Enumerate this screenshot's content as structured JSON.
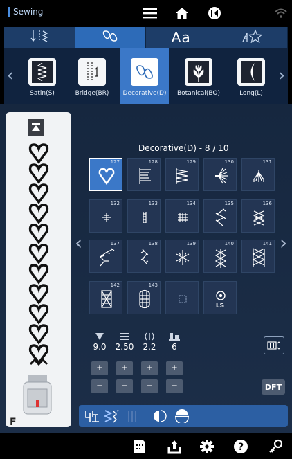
{
  "app": {
    "title": "Sewing"
  },
  "categories": [
    {
      "icon": "utility-stitch-icon"
    },
    {
      "icon": "decorative-stitch-icon"
    },
    {
      "icon": "character-font-icon",
      "label": "Aa"
    },
    {
      "icon": "stitch-favorites-icon"
    }
  ],
  "subcategories": [
    {
      "label": "Satin(S)",
      "icon": "satin-stitch-icon"
    },
    {
      "label": "Bridge(BR)",
      "icon": "bridge-stitch-icon"
    },
    {
      "label": "Decorative(D)",
      "icon": "decorative-stitch-icon",
      "active": true
    },
    {
      "label": "Botanical(BO)",
      "icon": "botanical-stitch-icon"
    },
    {
      "label": "Long(L)",
      "icon": "long-stitch-icon"
    }
  ],
  "grid": {
    "title": "Decorative(D) - 8 / 10",
    "selected": "127",
    "cells": [
      {
        "num": "127",
        "icon": "heart-stitch-icon"
      },
      {
        "num": "128",
        "icon": "comb-stitch-icon"
      },
      {
        "num": "129",
        "icon": "zigzag-comb-stitch-icon"
      },
      {
        "num": "130",
        "icon": "fan-stitch-icon"
      },
      {
        "num": "131",
        "icon": "crown-stitch-icon"
      },
      {
        "num": "132",
        "icon": "cross-stitch-icon"
      },
      {
        "num": "133",
        "icon": "ladder-stitch-icon"
      },
      {
        "num": "134",
        "icon": "hash-stitch-icon"
      },
      {
        "num": "135",
        "icon": "feather-stitch-icon"
      },
      {
        "num": "136",
        "icon": "star-stitch-icon"
      },
      {
        "num": "137",
        "icon": "branch-stitch-icon"
      },
      {
        "num": "138",
        "icon": "vine-stitch-icon"
      },
      {
        "num": "139",
        "icon": "snowflake-stitch-icon"
      },
      {
        "num": "140",
        "icon": "cross-chain-stitch-icon"
      },
      {
        "num": "141",
        "icon": "diamond-lattice-stitch-icon"
      },
      {
        "num": "142",
        "icon": "square-lattice-stitch-icon"
      },
      {
        "num": "143",
        "icon": "oval-lattice-stitch-icon"
      },
      {
        "num": "",
        "icon": "empty-slot-icon"
      },
      {
        "num": "",
        "icon": "locking-stitch-icon",
        "label": "LS"
      }
    ]
  },
  "params": [
    {
      "icon": "stitch-width-icon",
      "value": "9.0"
    },
    {
      "icon": "stitch-length-icon",
      "value": "2.50"
    },
    {
      "icon": "stitch-spacing-icon",
      "value": "2.2"
    },
    {
      "icon": "thread-tension-icon",
      "value": "6"
    }
  ],
  "buttons": {
    "plus": "+",
    "minus": "−",
    "dft": "DFT"
  },
  "toolbar_icons": [
    "needle-position-icon",
    "elongation-icon",
    "mirror-vertical-icon",
    "mirror-image-icon",
    "pattern-flip-icon"
  ],
  "bottom_icons": [
    "pattern-sheet-icon",
    "export-icon",
    "settings-icon",
    "help-icon",
    "key-icon"
  ],
  "foot": {
    "letter": "F"
  },
  "colors": {
    "accent": "#3b78c8",
    "tab_bar": "#1d3d68",
    "panel": "#16273f",
    "toolbar": "#2c5fa3"
  }
}
